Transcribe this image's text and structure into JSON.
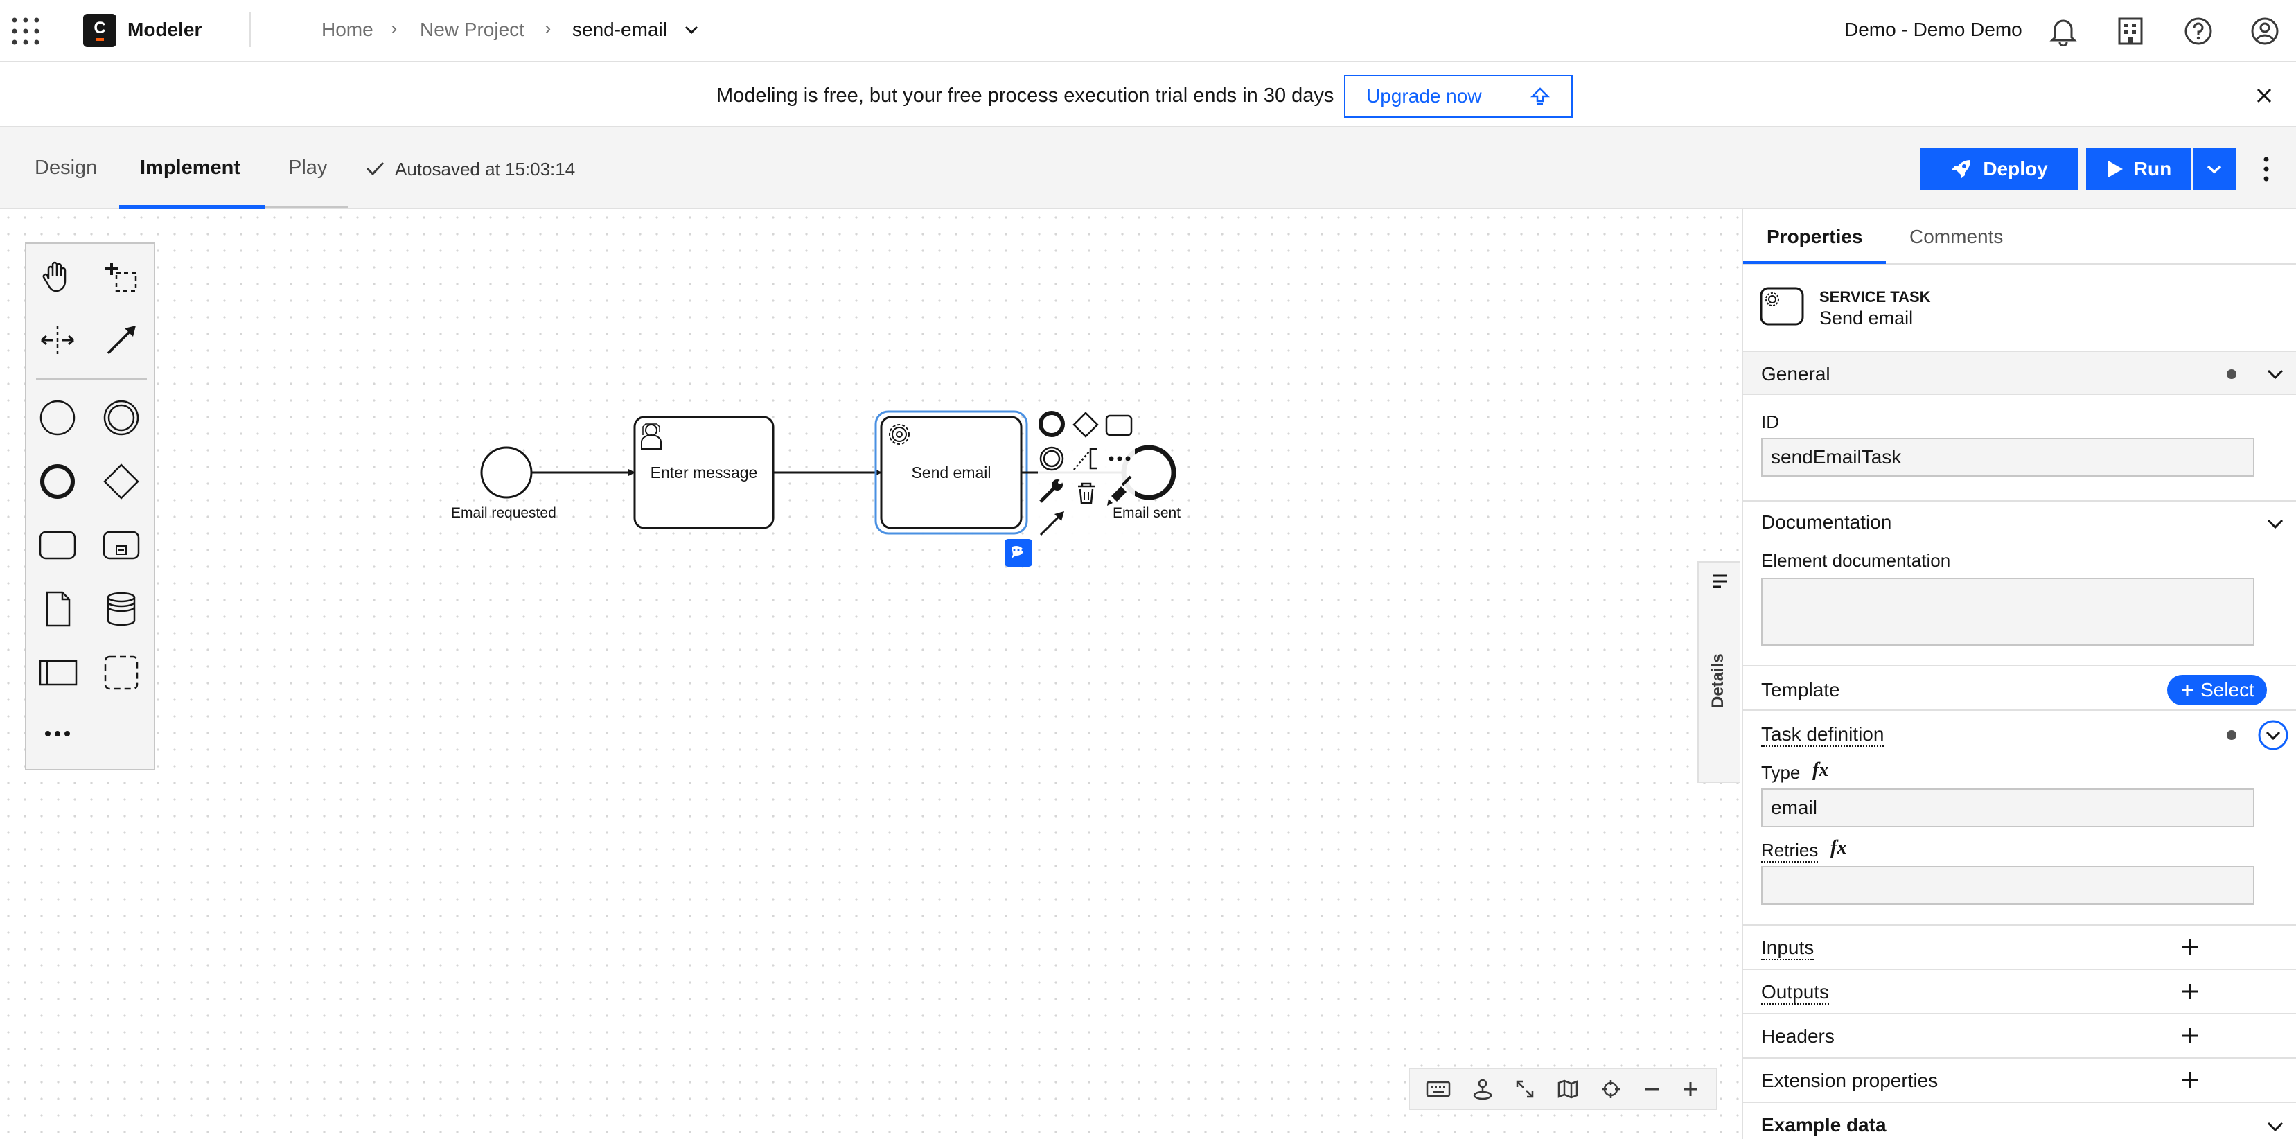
{
  "topbar": {
    "app_logo_letter": "C",
    "app_name": "Modeler",
    "breadcrumb": [
      "Home",
      "New Project",
      "send-email"
    ],
    "user": "Demo - Demo Demo"
  },
  "banner": {
    "message": "Modeling is free, but your free process execution trial ends in 30 days",
    "upgrade_label": "Upgrade now"
  },
  "toolbar": {
    "tabs": [
      "Design",
      "Implement",
      "Play"
    ],
    "active_tab": "Implement",
    "autosave": "Autosaved at 15:03:14",
    "deploy_label": "Deploy",
    "run_label": "Run"
  },
  "diagram": {
    "start_event_label": "Email requested",
    "user_task_label": "Enter message",
    "service_task_label": "Send email",
    "end_event_label": "Email sent"
  },
  "details_tab": "Details",
  "panel": {
    "tabs": [
      "Properties",
      "Comments"
    ],
    "active_tab": "Properties",
    "element_type": "SERVICE TASK",
    "element_name": "Send email",
    "general": {
      "title": "General",
      "id_label": "ID",
      "id_value": "sendEmailTask"
    },
    "documentation": {
      "title": "Documentation",
      "field_label": "Element documentation",
      "value": ""
    },
    "template": {
      "title": "Template",
      "select_label": "Select"
    },
    "task_definition": {
      "title": "Task definition",
      "type_label": "Type",
      "type_value": "email",
      "retries_label": "Retries",
      "retries_value": "",
      "fx": "fx"
    },
    "groups": [
      "Inputs",
      "Outputs",
      "Headers",
      "Extension properties",
      "Example data"
    ]
  },
  "colors": {
    "accent": "#0f62fe",
    "selection": "#4a90e2",
    "comment_badge": "#0f62fe"
  }
}
